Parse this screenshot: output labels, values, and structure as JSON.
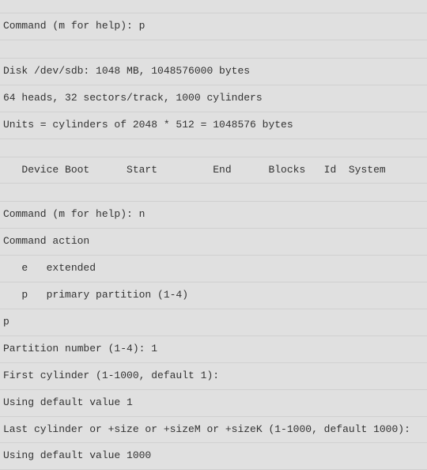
{
  "lines": {
    "cmd1_prompt": "Command (m for help): ",
    "cmd1_input": "p",
    "disk_info": "Disk /dev/sdb: 1048 MB, 1048576000 bytes",
    "geometry": "64 heads, 32 sectors/track, 1000 cylinders",
    "units": "Units = cylinders of 2048 * 512 = 1048576 bytes",
    "table_header": "   Device Boot      Start         End      Blocks   Id  System",
    "cmd2_prompt": "Command (m for help): ",
    "cmd2_input": "n",
    "command_action": "Command action",
    "action_e": "   e   extended",
    "action_p": "   p   primary partition (1-4)",
    "choice_input": "p",
    "partition_prompt": "Partition number (1-4): ",
    "partition_input": "1",
    "first_cyl_prompt": "First cylinder (1-1000, default 1):",
    "first_cyl_default": "Using default value 1",
    "last_cyl_prompt": "Last cylinder or +size or +sizeM or +sizeK (1-1000, default 1000):",
    "last_cyl_default": "Using default value 1000"
  }
}
